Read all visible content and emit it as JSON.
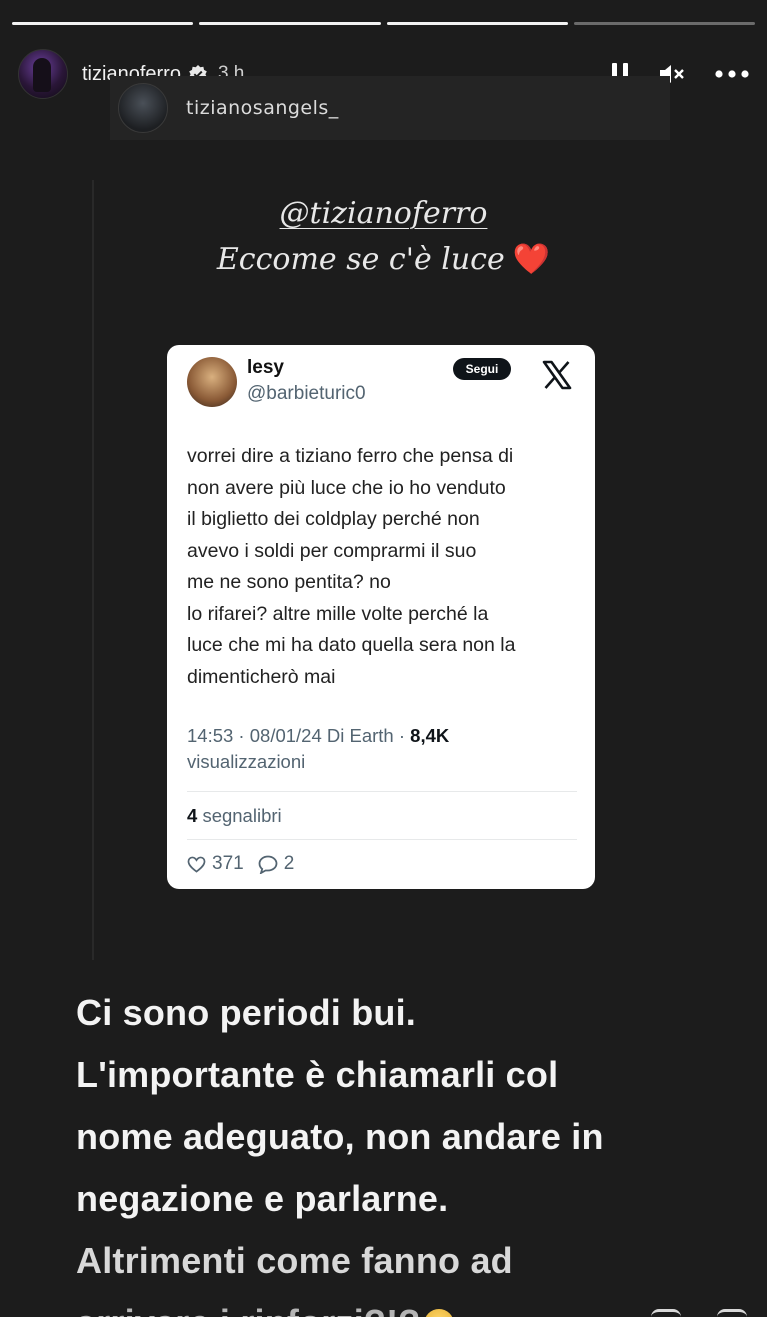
{
  "progress": [
    {
      "fill_fraction": 1.0
    },
    {
      "fill_fraction": 1.0
    },
    {
      "fill_fraction": 1.0
    },
    {
      "fill_fraction": 0.0
    }
  ],
  "header": {
    "username": "tizianoferro",
    "verified_icon": "verified-badge-icon",
    "time": "3 h",
    "controls": [
      "pause-icon",
      "mute-icon",
      "more-icon"
    ]
  },
  "reshare": {
    "username": "tizianosangels_"
  },
  "story": {
    "mention": "@tizianoferro",
    "caption": "Eccome se c'è luce",
    "caption_emoji": "❤️"
  },
  "tweet": {
    "name": "lesy",
    "handle": "@barbieturic0",
    "follow_label": "Segui",
    "platform_icon": "x-logo-icon",
    "text_lines": [
      "vorrei dire a tiziano ferro che pensa di",
      "non avere più luce che io ho venduto",
      "il biglietto dei coldplay perché non",
      "avevo i soldi per comprarmi il suo",
      "me ne sono pentita? no",
      "lo rifarei? altre mille volte perché la",
      "luce che mi ha dato quella sera non la",
      "dimenticherò mai"
    ],
    "meta": "14:53 · 08/01/24 Di Earth ·",
    "views_count": "8,4K",
    "views_label": "visualizzazioni",
    "bookmarks_count": "4",
    "bookmarks_label": "segnalibri",
    "likes": "371",
    "replies": "2"
  },
  "bottom_text": {
    "lines": [
      "Ci sono periodi bui.",
      "L'importante è chiamarli col",
      "nome adeguato, non andare in",
      "negazione e parlarne.",
      "Altrimenti come fanno ad",
      "arrivare i rinforzi?!?"
    ],
    "trailing_emoji": "pleading-face-emoji"
  },
  "colors": {
    "background": "#1c1c1c",
    "heart": "#e11d2a",
    "tweet_bg": "#ffffff",
    "tweet_secondary": "#536471"
  }
}
